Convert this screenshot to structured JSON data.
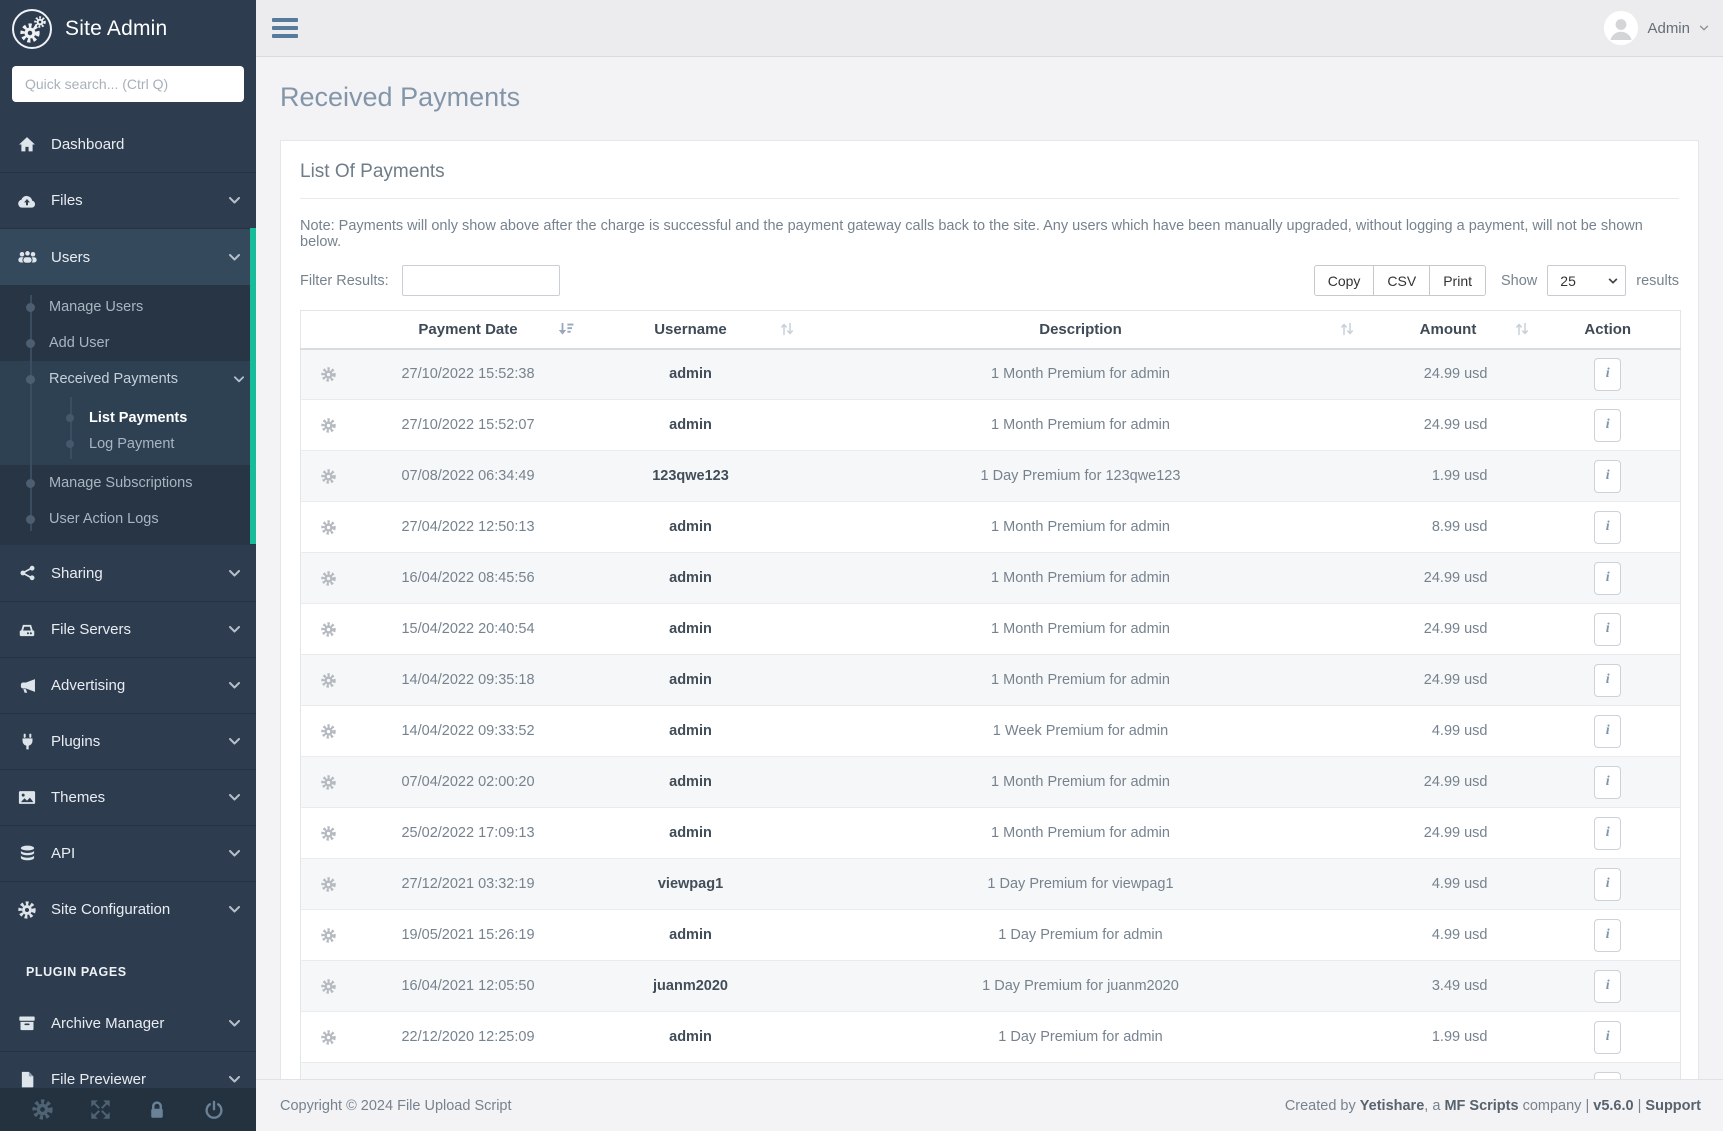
{
  "app": {
    "brand": "Site Admin"
  },
  "sidebar": {
    "search_placeholder": "Quick search... (Ctrl Q)",
    "menu": {
      "dashboard": "Dashboard",
      "files": "Files",
      "users": "Users",
      "manage_users": "Manage Users",
      "add_user": "Add User",
      "received_payments": "Received Payments",
      "list_payments": "List Payments",
      "log_payment": "Log Payment",
      "manage_subscriptions": "Manage Subscriptions",
      "user_action_logs": "User Action Logs",
      "sharing": "Sharing",
      "file_servers": "File Servers",
      "advertising": "Advertising",
      "plugins": "Plugins",
      "themes": "Themes",
      "api": "API",
      "site_configuration": "Site Configuration",
      "plugin_pages": "PLUGIN PAGES",
      "archive_manager": "Archive Manager",
      "file_previewer": "File Previewer"
    }
  },
  "header": {
    "user_label": "Admin"
  },
  "page": {
    "title": "Received Payments"
  },
  "card": {
    "title": "List Of Payments",
    "note": "Note: Payments will only show above after the charge is successful and the payment gateway calls back to the site. Any users which have been manually upgraded, without logging a payment, will not be shown below.",
    "filter_label": "Filter Results:",
    "filter_value": "",
    "copy_label": "Copy",
    "csv_label": "CSV",
    "print_label": "Print",
    "show_label": "Show",
    "page_size": "25",
    "results_label": "results",
    "info_glyph": "i"
  },
  "table": {
    "headers": {
      "payment_date": "Payment Date",
      "username": "Username",
      "description": "Description",
      "amount": "Amount",
      "action": "Action"
    },
    "rows": [
      {
        "date": "27/10/2022 15:52:38",
        "username": "admin",
        "description": "1 Month Premium for admin",
        "amount": "24.99 usd"
      },
      {
        "date": "27/10/2022 15:52:07",
        "username": "admin",
        "description": "1 Month Premium for admin",
        "amount": "24.99 usd"
      },
      {
        "date": "07/08/2022 06:34:49",
        "username": "123qwe123",
        "description": "1 Day Premium for 123qwe123",
        "amount": "1.99 usd"
      },
      {
        "date": "27/04/2022 12:50:13",
        "username": "admin",
        "description": "1 Month Premium for admin",
        "amount": "8.99 usd"
      },
      {
        "date": "16/04/2022 08:45:56",
        "username": "admin",
        "description": "1 Month Premium for admin",
        "amount": "24.99 usd"
      },
      {
        "date": "15/04/2022 20:40:54",
        "username": "admin",
        "description": "1 Month Premium for admin",
        "amount": "24.99 usd"
      },
      {
        "date": "14/04/2022 09:35:18",
        "username": "admin",
        "description": "1 Month Premium for admin",
        "amount": "24.99 usd"
      },
      {
        "date": "14/04/2022 09:33:52",
        "username": "admin",
        "description": "1 Week Premium for admin",
        "amount": "4.99 usd"
      },
      {
        "date": "07/04/2022 02:00:20",
        "username": "admin",
        "description": "1 Month Premium for admin",
        "amount": "24.99 usd"
      },
      {
        "date": "25/02/2022 17:09:13",
        "username": "admin",
        "description": "1 Month Premium for admin",
        "amount": "24.99 usd"
      },
      {
        "date": "27/12/2021 03:32:19",
        "username": "viewpag1",
        "description": "1 Day Premium for viewpag1",
        "amount": "4.99 usd"
      },
      {
        "date": "19/05/2021 15:26:19",
        "username": "admin",
        "description": "1 Day Premium for admin",
        "amount": "4.99 usd"
      },
      {
        "date": "16/04/2021 12:05:50",
        "username": "juanm2020",
        "description": "1 Day Premium for juanm2020",
        "amount": "3.49 usd"
      },
      {
        "date": "22/12/2020 12:25:09",
        "username": "admin",
        "description": "1 Day Premium for admin",
        "amount": "1.99 usd"
      }
    ]
  },
  "footer": {
    "copyright": "Copyright © 2024 File Upload Script",
    "created_prefix": "Created by ",
    "brand1": "Yetishare",
    "mid": ", a ",
    "brand2": "MF Scripts",
    "suffix": " company",
    "sep": "  |  ",
    "version": "v5.6.0",
    "support": "Support"
  },
  "colors": {
    "sidebar_bg": "#2d3c4e",
    "sidebar_submenu_bg": "#273544",
    "accent_teal": "#18bc9b",
    "topbar_bg": "#ececee",
    "content_bg": "#f3f3f5",
    "heading_text": "#8396a9",
    "muted_text": "#76838f",
    "stripe_row": "#f6f7f8"
  }
}
